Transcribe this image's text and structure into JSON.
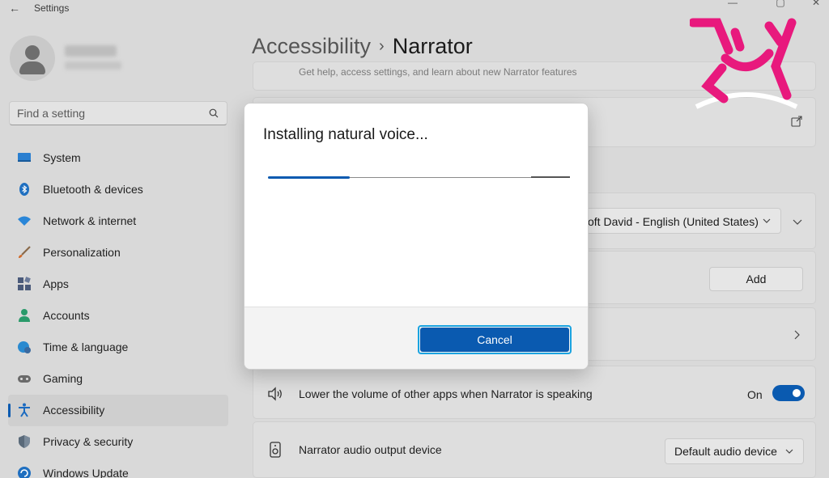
{
  "window": {
    "title": "Settings"
  },
  "search": {
    "placeholder": "Find a setting"
  },
  "sidebar": {
    "items": [
      {
        "label": "System",
        "icon": "monitor-icon"
      },
      {
        "label": "Bluetooth & devices",
        "icon": "bluetooth-icon"
      },
      {
        "label": "Network & internet",
        "icon": "wifi-icon"
      },
      {
        "label": "Personalization",
        "icon": "brush-icon"
      },
      {
        "label": "Apps",
        "icon": "apps-icon"
      },
      {
        "label": "Accounts",
        "icon": "person-icon"
      },
      {
        "label": "Time & language",
        "icon": "globe-clock-icon"
      },
      {
        "label": "Gaming",
        "icon": "gamepad-icon"
      },
      {
        "label": "Accessibility",
        "icon": "accessibility-icon",
        "selected": true
      },
      {
        "label": "Privacy & security",
        "icon": "shield-icon"
      },
      {
        "label": "Windows Update",
        "icon": "update-icon"
      }
    ]
  },
  "breadcrumb": {
    "parent": "Accessibility",
    "separator": "›",
    "current": "Narrator"
  },
  "main": {
    "top_card_sub": "Get help, access settings, and learn about new Narrator features",
    "voice_select_value": "oft David - English (United States)",
    "add_button": "Add",
    "lower_volume": {
      "label": "Lower the volume of other apps when Narrator is speaking",
      "state_label": "On",
      "on": true
    },
    "audio_device": {
      "label": "Narrator audio output device",
      "value": "Default audio device"
    }
  },
  "dialog": {
    "title": "Installing natural voice...",
    "progress": 0.27,
    "cancel_label": "Cancel"
  },
  "colors": {
    "accent": "#0a5ab0",
    "focus_ring": "#1aa3e0",
    "watermark": "#e8197d"
  }
}
